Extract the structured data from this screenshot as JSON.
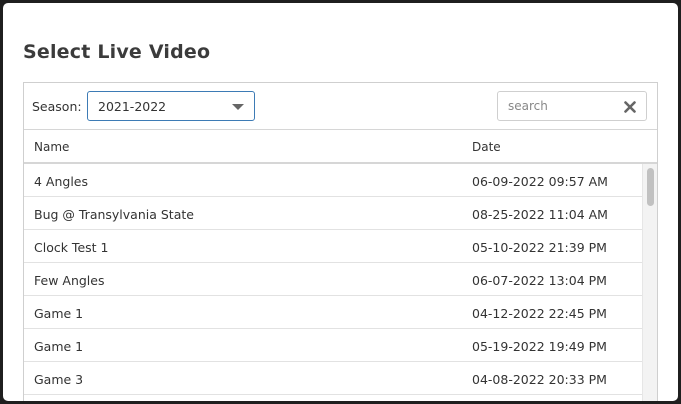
{
  "dialog": {
    "title": "Select Live Video"
  },
  "toolbar": {
    "season_label": "Season:",
    "season_value": "2021-2022",
    "search_placeholder": "search",
    "search_value": ""
  },
  "table": {
    "columns": [
      "Name",
      "Date"
    ],
    "rows": [
      {
        "name": "4 Angles",
        "date": "06-09-2022 09:57 AM"
      },
      {
        "name": "Bug @ Transylvania State",
        "date": "08-25-2022 11:04 AM"
      },
      {
        "name": "Clock Test 1",
        "date": "05-10-2022 21:39 PM"
      },
      {
        "name": "Few Angles",
        "date": "06-07-2022 13:04 PM"
      },
      {
        "name": "Game 1",
        "date": "04-12-2022 22:45 PM"
      },
      {
        "name": "Game 1",
        "date": "05-19-2022 19:49 PM"
      },
      {
        "name": "Game 3",
        "date": "04-08-2022 20:33 PM"
      }
    ]
  },
  "icons": {
    "season_dropdown": "chevron-down-icon",
    "search_clear": "close-icon"
  },
  "colors": {
    "select_border": "#3d7bb5",
    "title_text": "#3b3b3b"
  }
}
